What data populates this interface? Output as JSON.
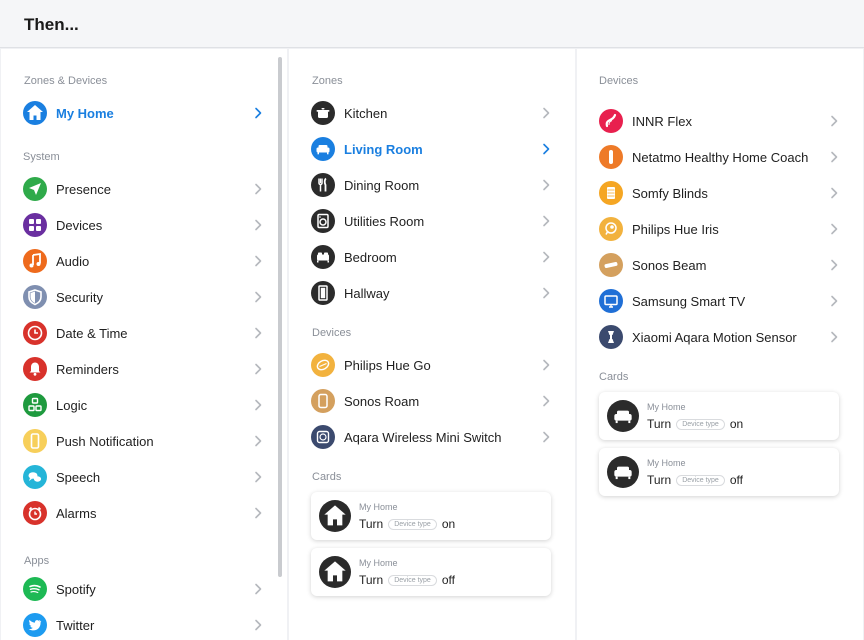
{
  "header": {
    "title": "Then..."
  },
  "col1": {
    "zones_title": "Zones & Devices",
    "zones": [
      {
        "label": "My Home",
        "icon": "home-icon",
        "color": "#1a7fe0"
      }
    ],
    "system_title": "System",
    "system": [
      {
        "label": "Presence",
        "icon": "location-arrow-icon",
        "color": "#2faa4a"
      },
      {
        "label": "Devices",
        "icon": "grid-icon",
        "color": "#6a2fa0"
      },
      {
        "label": "Audio",
        "icon": "music-note-icon",
        "color": "#ee6a1c"
      },
      {
        "label": "Security",
        "icon": "shield-icon",
        "color": "#7f8fb0"
      },
      {
        "label": "Date & Time",
        "icon": "clock-icon",
        "color": "#d8322b"
      },
      {
        "label": "Reminders",
        "icon": "bell-icon",
        "color": "#d8322b"
      },
      {
        "label": "Logic",
        "icon": "logic-blocks-icon",
        "color": "#1e9a3e"
      },
      {
        "label": "Push Notification",
        "icon": "phone-icon",
        "color": "#f7cf5a"
      },
      {
        "label": "Speech",
        "icon": "speech-bubbles-icon",
        "color": "#25b5d8"
      },
      {
        "label": "Alarms",
        "icon": "alarm-clock-icon",
        "color": "#d8322b"
      }
    ],
    "apps_title": "Apps",
    "apps": [
      {
        "label": "Spotify",
        "icon": "spotify-icon",
        "color": "#1db954"
      },
      {
        "label": "Twitter",
        "icon": "twitter-bird-icon",
        "color": "#1d9bf0"
      }
    ]
  },
  "col2": {
    "zones_title": "Zones",
    "zones": [
      {
        "label": "Kitchen",
        "icon": "cooking-pot-icon",
        "color": "#2b2b2b"
      },
      {
        "label": "Living Room",
        "icon": "sofa-icon",
        "color": "#1a7fe0"
      },
      {
        "label": "Dining Room",
        "icon": "fork-knife-icon",
        "color": "#2b2b2b"
      },
      {
        "label": "Utilities Room",
        "icon": "washing-machine-icon",
        "color": "#2b2b2b"
      },
      {
        "label": "Bedroom",
        "icon": "bed-icon",
        "color": "#2b2b2b"
      },
      {
        "label": "Hallway",
        "icon": "door-icon",
        "color": "#2b2b2b"
      }
    ],
    "devices_title": "Devices",
    "devices": [
      {
        "label": "Philips Hue Go",
        "icon": "hue-go-lamp-icon",
        "color": "#f2b23e"
      },
      {
        "label": "Sonos Roam",
        "icon": "speaker-icon",
        "color": "#d4a05e"
      },
      {
        "label": "Aqara Wireless Mini Switch",
        "icon": "mini-switch-icon",
        "color": "#3b4a6e"
      }
    ],
    "cards_title": "Cards",
    "cards": [
      {
        "title": "My Home",
        "turn": "Turn",
        "pill": "Device type",
        "state": "on",
        "icon": "home-icon"
      },
      {
        "title": "My Home",
        "turn": "Turn",
        "pill": "Device type",
        "state": "off",
        "icon": "home-icon"
      }
    ]
  },
  "col3": {
    "devices_title": "Devices",
    "devices": [
      {
        "label": "INNR Flex",
        "icon": "light-strip-icon",
        "color": "#e8204e"
      },
      {
        "label": "Netatmo Healthy Home Coach",
        "icon": "sensor-tube-icon",
        "color": "#ee7a28"
      },
      {
        "label": "Somfy Blinds",
        "icon": "blinds-icon",
        "color": "#f5a623"
      },
      {
        "label": "Philips Hue Iris",
        "icon": "hue-iris-lamp-icon",
        "color": "#f2b23e"
      },
      {
        "label": "Sonos Beam",
        "icon": "soundbar-icon",
        "color": "#d4a05e"
      },
      {
        "label": "Samsung Smart TV",
        "icon": "tv-icon",
        "color": "#1f6fd6"
      },
      {
        "label": "Xiaomi Aqara Motion Sensor",
        "icon": "motion-sensor-icon",
        "color": "#3b4a6e"
      }
    ],
    "cards_title": "Cards",
    "cards": [
      {
        "title": "My Home",
        "turn": "Turn",
        "pill": "Device type",
        "state": "on",
        "icon": "sofa-icon"
      },
      {
        "title": "My Home",
        "turn": "Turn",
        "pill": "Device type",
        "state": "off",
        "icon": "sofa-icon"
      }
    ]
  },
  "chevron_colors": {
    "default": "#b5b8bd",
    "active": "#1a7fe0"
  }
}
